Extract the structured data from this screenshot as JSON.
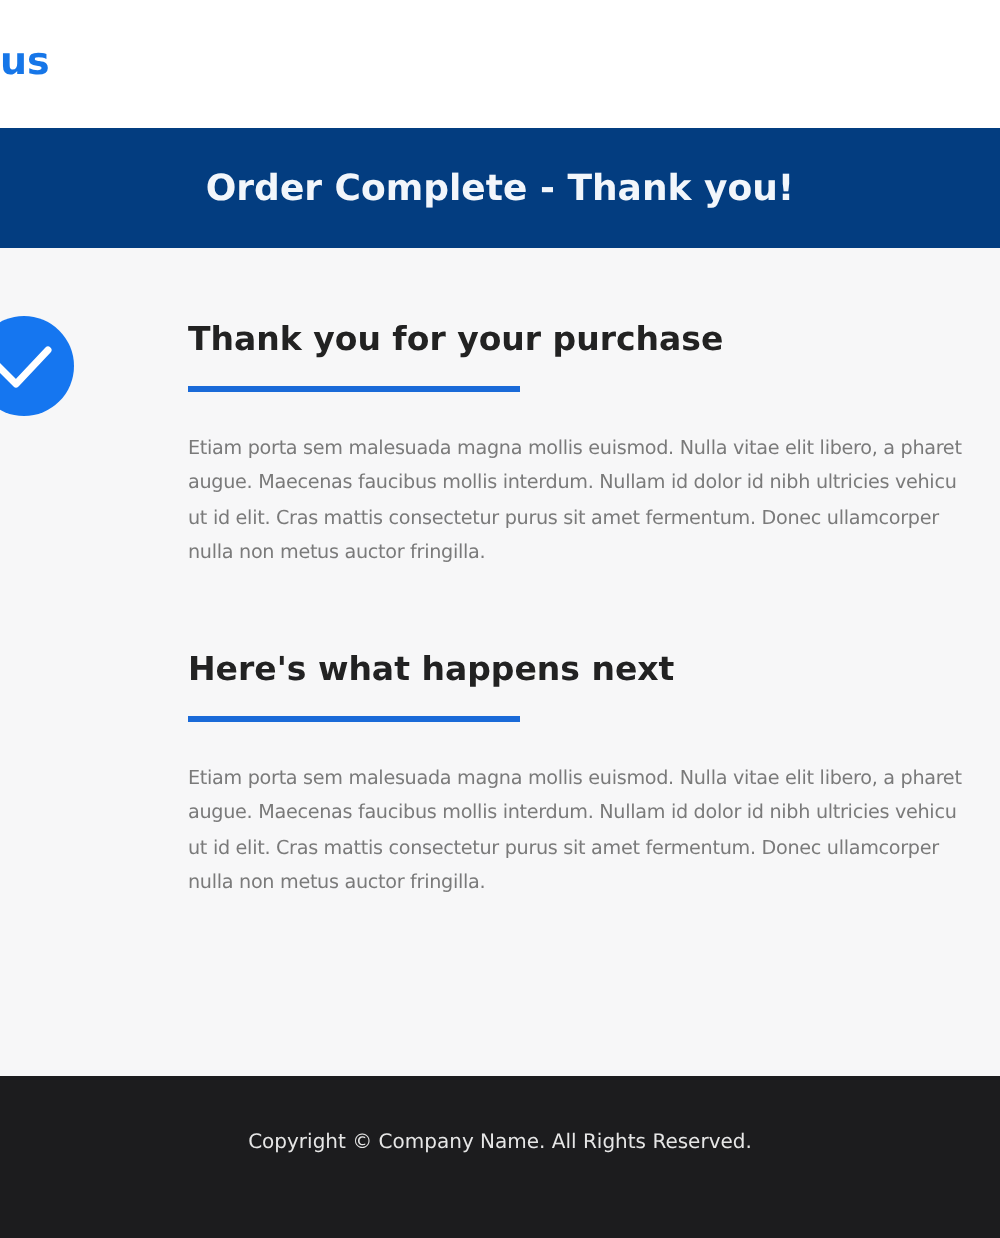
{
  "logo": "us",
  "banner": {
    "title": "Order Complete - Thank you!"
  },
  "sections": [
    {
      "heading": "Thank you for your purchase",
      "lines": [
        "Etiam porta sem malesuada magna mollis euismod. Nulla vitae elit libero, a pharet",
        "augue. Maecenas faucibus mollis interdum. Nullam id dolor id nibh ultricies vehicu",
        "ut id elit. Cras mattis consectetur purus sit amet fermentum. Donec ullamcorper",
        "nulla non metus auctor fringilla."
      ]
    },
    {
      "heading": "Here's what happens next",
      "lines": [
        "Etiam porta sem malesuada magna mollis euismod. Nulla vitae elit libero, a pharet",
        "augue. Maecenas faucibus mollis interdum. Nullam id dolor id nibh ultricies vehicu",
        "ut id elit. Cras mattis consectetur purus sit amet fermentum. Donec ullamcorper",
        "nulla non metus auctor fringilla."
      ]
    }
  ],
  "footer": {
    "text": "Copyright © Company Name. All Rights Reserved."
  }
}
